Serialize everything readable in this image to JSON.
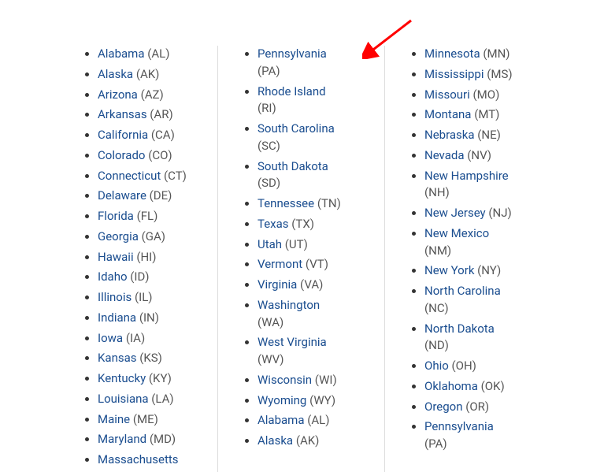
{
  "columns": [
    {
      "items": [
        {
          "name": "Alabama",
          "abbr": "AL"
        },
        {
          "name": "Alaska",
          "abbr": "AK"
        },
        {
          "name": "Arizona",
          "abbr": "AZ"
        },
        {
          "name": "Arkansas",
          "abbr": "AR"
        },
        {
          "name": "California",
          "abbr": "CA"
        },
        {
          "name": "Colorado",
          "abbr": "CO"
        },
        {
          "name": "Connecticut",
          "abbr": "CT"
        },
        {
          "name": "Delaware",
          "abbr": "DE"
        },
        {
          "name": "Florida",
          "abbr": "FL"
        },
        {
          "name": "Georgia",
          "abbr": "GA"
        },
        {
          "name": "Hawaii",
          "abbr": "HI"
        },
        {
          "name": "Idaho",
          "abbr": "ID"
        },
        {
          "name": "Illinois",
          "abbr": "IL"
        },
        {
          "name": "Indiana",
          "abbr": "IN"
        },
        {
          "name": "Iowa",
          "abbr": "IA"
        },
        {
          "name": "Kansas",
          "abbr": "KS"
        },
        {
          "name": "Kentucky",
          "abbr": "KY"
        },
        {
          "name": "Louisiana",
          "abbr": "LA"
        },
        {
          "name": "Maine",
          "abbr": "ME"
        },
        {
          "name": "Maryland",
          "abbr": "MD"
        },
        {
          "name": "Massachusetts",
          "abbr": ""
        }
      ]
    },
    {
      "items": [
        {
          "name": "Pennsylvania",
          "abbr": "PA",
          "wrap": true
        },
        {
          "name": "Rhode Island",
          "abbr": "RI",
          "wrap": true
        },
        {
          "name": "South Carolina",
          "abbr": "SC",
          "wrap": true
        },
        {
          "name": "South Dakota",
          "abbr": "SD",
          "wrap": true
        },
        {
          "name": "Tennessee",
          "abbr": "TN"
        },
        {
          "name": "Texas",
          "abbr": "TX"
        },
        {
          "name": "Utah",
          "abbr": "UT"
        },
        {
          "name": "Vermont",
          "abbr": "VT"
        },
        {
          "name": "Virginia",
          "abbr": "VA"
        },
        {
          "name": "Washington",
          "abbr": "WA",
          "wrap": true
        },
        {
          "name": "West Virginia",
          "abbr": "WV",
          "wrap": true
        },
        {
          "name": "Wisconsin",
          "abbr": "WI"
        },
        {
          "name": "Wyoming",
          "abbr": "WY"
        },
        {
          "name": "Alabama",
          "abbr": "AL"
        },
        {
          "name": "Alaska",
          "abbr": "AK"
        }
      ]
    },
    {
      "items": [
        {
          "name": "Minnesota",
          "abbr": "MN"
        },
        {
          "name": "Mississippi",
          "abbr": "MS"
        },
        {
          "name": "Missouri",
          "abbr": "MO"
        },
        {
          "name": "Montana",
          "abbr": "MT"
        },
        {
          "name": "Nebraska",
          "abbr": "NE"
        },
        {
          "name": "Nevada",
          "abbr": "NV"
        },
        {
          "name": "New Hampshire",
          "abbr": "NH",
          "wrap": true
        },
        {
          "name": "New Jersey",
          "abbr": "NJ"
        },
        {
          "name": "New Mexico",
          "abbr": "NM",
          "wrap": true
        },
        {
          "name": "New York",
          "abbr": "NY"
        },
        {
          "name": "North Carolina",
          "abbr": "NC",
          "wrap": true
        },
        {
          "name": "North Dakota",
          "abbr": "ND",
          "wrap": true
        },
        {
          "name": "Ohio",
          "abbr": "OH"
        },
        {
          "name": "Oklahoma",
          "abbr": "OK"
        },
        {
          "name": "Oregon",
          "abbr": "OR"
        },
        {
          "name": "Pennsylvania",
          "abbr": "PA",
          "wrap": true
        }
      ]
    }
  ]
}
